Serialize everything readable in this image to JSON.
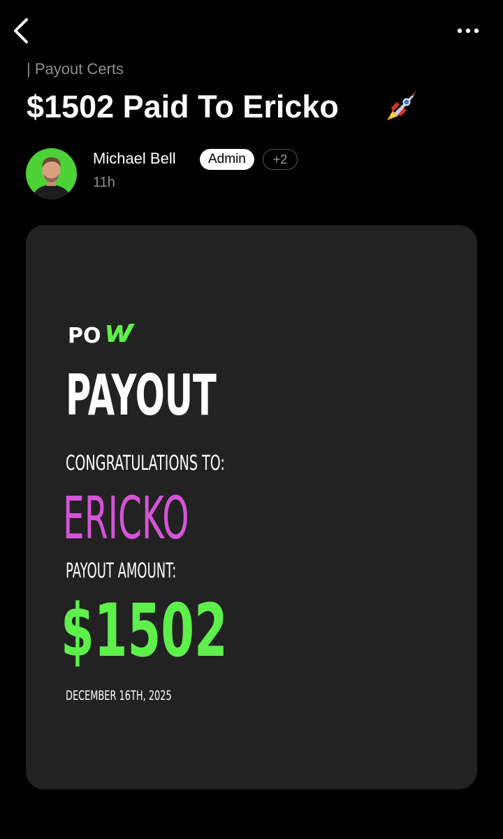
{
  "nav": {
    "back_icon": "chevron-left-icon",
    "more_icon": "more-horizontal-icon"
  },
  "post": {
    "category": "| Payout Certs",
    "title": "$1502 Paid To Ericko",
    "title_emoji": "rocket-icon",
    "author": {
      "name": "Michael Bell",
      "role_badge": "Admin",
      "extra_badges": "+2",
      "time": "11h",
      "avatar_bg": "#4cd137"
    }
  },
  "certificate": {
    "logo_text": "POW",
    "heading": "PAYOUT",
    "congrats_label": "CONGRATULATIONS TO:",
    "recipient": "ERICKO",
    "amount_label": "PAYOUT AMOUNT:",
    "amount": "$1502",
    "date": "DECEMBER 16TH, 2025",
    "colors": {
      "card_bg": "#222222",
      "recipient": "#d454d8",
      "amount": "#5ef04a",
      "logo_accent": "#5ef04a"
    }
  }
}
